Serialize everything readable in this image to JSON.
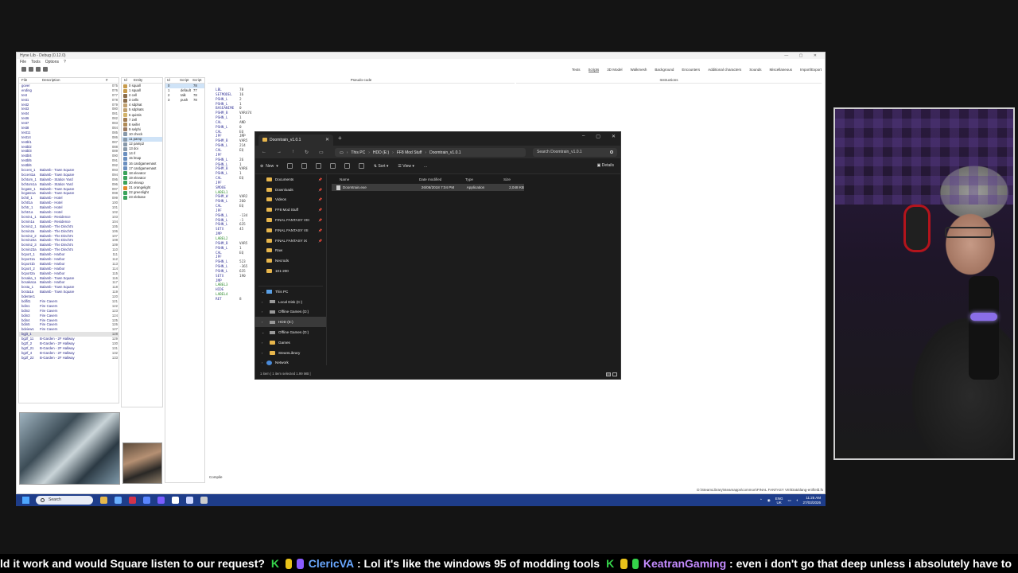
{
  "hyne": {
    "title": "Hyne Lib - Debug (0.12.0)",
    "menu": [
      "File",
      "Tools",
      "Options",
      "?"
    ],
    "tabs": [
      "Texts",
      "Scripts",
      "3D Model",
      "Walkmesh",
      "Background",
      "Encounters",
      "Additional characters",
      "Sounds",
      "Miscellaneous",
      "Import/Export"
    ],
    "field_headers": [
      "File",
      "Description",
      "#"
    ],
    "fields": [
      [
        "gover",
        "",
        "075"
      ],
      [
        "ending",
        "",
        "076"
      ],
      [
        "test",
        "",
        "077"
      ],
      [
        "test1",
        "",
        "078"
      ],
      [
        "test2",
        "",
        "079"
      ],
      [
        "test3",
        "",
        "080"
      ],
      [
        "test4",
        "",
        "081"
      ],
      [
        "test6",
        "",
        "082"
      ],
      [
        "test7",
        "",
        "083"
      ],
      [
        "test8",
        "",
        "084"
      ],
      [
        "test11",
        "",
        "085"
      ],
      [
        "test14",
        "",
        "086"
      ],
      [
        "testbl1",
        "",
        "087"
      ],
      [
        "testbl2",
        "",
        "088"
      ],
      [
        "testbl3",
        "",
        "089"
      ],
      [
        "testbl4",
        "",
        "090"
      ],
      [
        "testbl5",
        "",
        "091"
      ],
      [
        "testbl6",
        "",
        "092"
      ],
      [
        "bccent_1",
        "Balamb - Town Square",
        "093"
      ],
      [
        "bccent1a",
        "Balamb - Town Square",
        "094"
      ],
      [
        "bchtom_1",
        "Balamb - Station Yard",
        "095"
      ],
      [
        "bchtom1a",
        "Balamb - Station Yard",
        "096"
      ],
      [
        "bcgate_1",
        "Balamb - Town Square",
        "097"
      ],
      [
        "bcgate1a",
        "Balamb - Town Square",
        "098"
      ],
      [
        "bchtl_1",
        "Balamb - Hotel",
        "099"
      ],
      [
        "bchtl1a",
        "Balamb - Hotel",
        "100"
      ],
      [
        "bchtr_1",
        "Balamb - Hotel",
        "101"
      ],
      [
        "bchtr1a",
        "Balamb - Hotel",
        "102"
      ],
      [
        "bcmin1_1",
        "Balamb - Residence",
        "103"
      ],
      [
        "bcmin1a",
        "Balamb - Residence",
        "104"
      ],
      [
        "bcmin2_1",
        "Balamb - The Dincht's",
        "105"
      ],
      [
        "bcmin2a",
        "Balamb - The Dincht's",
        "106"
      ],
      [
        "bcmin2_2",
        "Balamb - The Dincht's",
        "107"
      ],
      [
        "bcmin22a",
        "Balamb - The Dincht's",
        "108"
      ],
      [
        "bcmin2_3",
        "Balamb - The Dincht's",
        "109"
      ],
      [
        "bcmin23a",
        "Balamb - The Dincht's",
        "110"
      ],
      [
        "bcport_1",
        "Balamb - Harbor",
        "111"
      ],
      [
        "bcport1a",
        "Balamb - Harbor",
        "112"
      ],
      [
        "bcport1b",
        "Balamb - Harbor",
        "113"
      ],
      [
        "bcport_2",
        "Balamb - Harbor",
        "114"
      ],
      [
        "bcport2a",
        "Balamb - Harbor",
        "115"
      ],
      [
        "bcsaka_1",
        "Balamb - Town Square",
        "116"
      ],
      [
        "bcsaka1a",
        "Balamb - Harbor",
        "117"
      ],
      [
        "bcsta_1",
        "Balamb - Town Square",
        "118"
      ],
      [
        "bcsta1a",
        "Balamb - Town Square",
        "119"
      ],
      [
        "bdenter1",
        "",
        "120"
      ],
      [
        "bdifit1",
        "Fire Cavern",
        "121"
      ],
      [
        "bdin1",
        "Fire Cavern",
        "122"
      ],
      [
        "bdin2",
        "Fire Cavern",
        "123"
      ],
      [
        "bdin3",
        "Fire Cavern",
        "124"
      ],
      [
        "bdin4",
        "Fire Cavern",
        "125"
      ],
      [
        "bdin5",
        "Fire Cavern",
        "126"
      ],
      [
        "bdview1",
        "Fire Cavern",
        "127"
      ],
      [
        "bgjit_1",
        "",
        "128"
      ],
      [
        "bg2f_11",
        "B-Garden - 2F Hallway",
        "129"
      ],
      [
        "bg2f_2",
        "B-Garden - 2F Hallway",
        "130"
      ],
      [
        "bg2f_21",
        "B-Garden - 2F Hallway",
        "131"
      ],
      [
        "bg2f_4",
        "B-Garden - 2F Hallway",
        "132"
      ],
      [
        "bg2f_22",
        "B-Garden - 2F Hallway",
        "133"
      ]
    ],
    "entity_headers": [
      "Id",
      "Entity"
    ],
    "entities": [
      "0  squall",
      "1  squall",
      "2  cell",
      "3  cells",
      "4  sdphat",
      "5  sdphats",
      "6  quistis",
      "7  zell",
      "8  seifer",
      "9  selphi",
      "10 check",
      "11 pamp",
      "12 pamp2",
      "13 doi",
      "14 rl",
      "15 lmap",
      "16 cardgamemast",
      "17 cardgamemast",
      "18 elevator",
      "19 elevator",
      "20 elevup",
      "21 orangelight",
      "22 greenlight",
      "23 elebase"
    ],
    "entity_colors": [
      "#c79a4a",
      "#c79a4a",
      "#8a6d4b",
      "#8a6d4b",
      "#c0a070",
      "#c0a070",
      "#d2b36a",
      "#a07a50",
      "#b08a55",
      "#9c7a60",
      "#8899aa",
      "#8899aa",
      "#8899aa",
      "#8899aa",
      "#6a8fbf",
      "#6a8fbf",
      "#6a8fbf",
      "#6a8fbf",
      "#3aa35a",
      "#3aa35a",
      "#3aa35a",
      "#e08a2a",
      "#3aa35a",
      "#3aa35a"
    ],
    "script_headers": [
      "Id",
      "Script",
      "Script"
    ],
    "scripts": [
      [
        "0",
        "",
        "78"
      ],
      [
        "1",
        "default",
        "77"
      ],
      [
        "2",
        "talk",
        "78"
      ],
      [
        "3",
        "push",
        "78"
      ]
    ],
    "pseudo_code_header": "Pseudo-code",
    "instructions_header": "Instructions",
    "code": [
      [
        "LBL",
        "78"
      ],
      [
        "SETMODEL",
        "16"
      ],
      [
        "PSHN_L",
        "2"
      ],
      [
        "PSHN_L",
        "1"
      ],
      [
        "BASEANIME",
        "0"
      ],
      [
        "PSHM_B",
        "VAR474"
      ],
      [
        "PSHN_L",
        "1"
      ],
      [
        "CAL",
        "AND"
      ],
      [
        "PSHN_L",
        "0"
      ],
      [
        "CAL",
        "EQ"
      ],
      [
        "JPF",
        "JMP"
      ],
      [
        "PSHM_B",
        "VAR5"
      ],
      [
        "PSHN_L",
        "214"
      ],
      [
        "CAL",
        "EQ"
      ],
      [
        "JPF",
        ""
      ],
      [
        "PSHN_L",
        "26"
      ],
      [
        "PSHN_L",
        "1"
      ],
      [
        "PSHM_B",
        "VAR6"
      ],
      [
        "PSHN_L",
        "1"
      ],
      [
        "CAL",
        "EQ"
      ],
      [
        "JPF",
        ""
      ],
      [
        "SMOOE",
        ""
      ],
      [
        "LABEL1",
        ""
      ],
      [
        "PSHM_W",
        "VAR2"
      ],
      [
        "PSHN_L",
        "260"
      ],
      [
        "CAL",
        "EQ"
      ],
      [
        "JPF",
        ""
      ],
      [
        "PSHN_L",
        "-134"
      ],
      [
        "PSHN_L",
        "-1"
      ],
      [
        "PSHN_L",
        "635"
      ],
      [
        "SETX",
        "45"
      ],
      [
        "JMP",
        ""
      ],
      [
        "LABEL2",
        ""
      ],
      [
        "PSHM_B",
        "VAR5"
      ],
      [
        "PSHN_L",
        "1"
      ],
      [
        "CAL",
        "EQ"
      ],
      [
        "JPF",
        ""
      ],
      [
        "PSHN_L",
        "523"
      ],
      [
        "PSHN_L",
        "-365"
      ],
      [
        "PSHN_L",
        "635"
      ],
      [
        "SETX",
        "190"
      ],
      [
        "JMP",
        ""
      ],
      [
        "LABEL3",
        ""
      ],
      [
        "HIDE",
        ""
      ],
      [
        "LABEL4",
        ""
      ],
      [
        "RET",
        "8"
      ]
    ],
    "compile_label": "Compile",
    "status_path": "D:\\SteamLibrary\\steamapps\\common\\FINAL FANTASY VIII\\Data\\lang-en\\field.fs"
  },
  "taskbar": {
    "search_placeholder": "Search",
    "lang_line1": "ENG",
    "lang_line2": "UK",
    "time": "11:25 AM",
    "date": "27/03/2026",
    "app_colors": [
      "#e6b84c",
      "#6ab0ff",
      "#d2334a",
      "#5a86ff",
      "#7b5cff",
      "#ffffff",
      "#cfd8ff",
      "#cccccc"
    ]
  },
  "explorer": {
    "tab_title": "Doomtrain_v1.0.1",
    "path": [
      "This PC",
      "HDD (E:)",
      "FF8 Mod Stuff",
      "Doomtrain_v1.0.1"
    ],
    "search_placeholder": "Search Doomtrain_v1.0.1",
    "cmd": {
      "new": "New",
      "sort": "Sort",
      "view": "View",
      "more": "...",
      "details": "Details"
    },
    "nav": {
      "quick": [
        "Documents",
        "Downloads",
        "Videos",
        "FF8 Mod Stuff",
        "FINAL FANTASY VIII",
        "FINAL FANTASY VII",
        "FINAL FANTASY IX",
        "Raw",
        "Necrods",
        "101-200"
      ],
      "this_pc": "This PC",
      "drives": [
        "Local Disk (C:)",
        "Offline Games (D:)",
        "HDD (E:)",
        "Offline Games (D:)"
      ],
      "folders": [
        "Games",
        "SteamLibrary"
      ],
      "network": "Network"
    },
    "columns": [
      "Name",
      "Date modified",
      "Type",
      "Size"
    ],
    "files": [
      {
        "name": "Doomtrain.exe",
        "date": "26/06/2018 7:04 PM",
        "type": "Application",
        "size": "2,048 KB"
      }
    ],
    "status": "1 item  |  1 item selected  1.99 MB  |"
  },
  "ticker": {
    "msg1": "ld it work and would Square listen to our request?",
    "user1": "ClericVA",
    "msg2": "Lol it's like the windows 95 of modding tools",
    "user2": "KeatranGaming",
    "msg3": "even i don't go that deep unless i absolutely have to",
    "badge_colors": [
      "#35d24a",
      "#e8c21a",
      "#8a5bff",
      "#e8c21a",
      "#35d24a"
    ]
  }
}
